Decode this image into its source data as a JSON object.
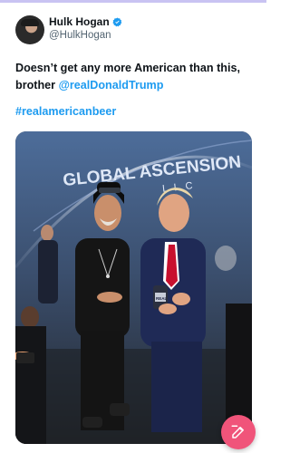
{
  "tweet": {
    "author_name": "Hulk Hogan",
    "author_handle": "@HulkHogan",
    "text_before": "Doesn’t get any more American than this, brother ",
    "mention": "@realDonaldTrump",
    "hashtag": "#realamericanbeer"
  },
  "media": {
    "backdrop_text": "GLOBAL ASCENSION",
    "backdrop_subtext": "L L C",
    "can_label": "REAL"
  },
  "icons": {
    "verified": "verified-badge-icon",
    "compose": "compose-pencil-icon"
  },
  "colors": {
    "accent": "#1d9bf0",
    "fab": "#f0547a",
    "text": "#0f1419",
    "muted": "#536471"
  }
}
